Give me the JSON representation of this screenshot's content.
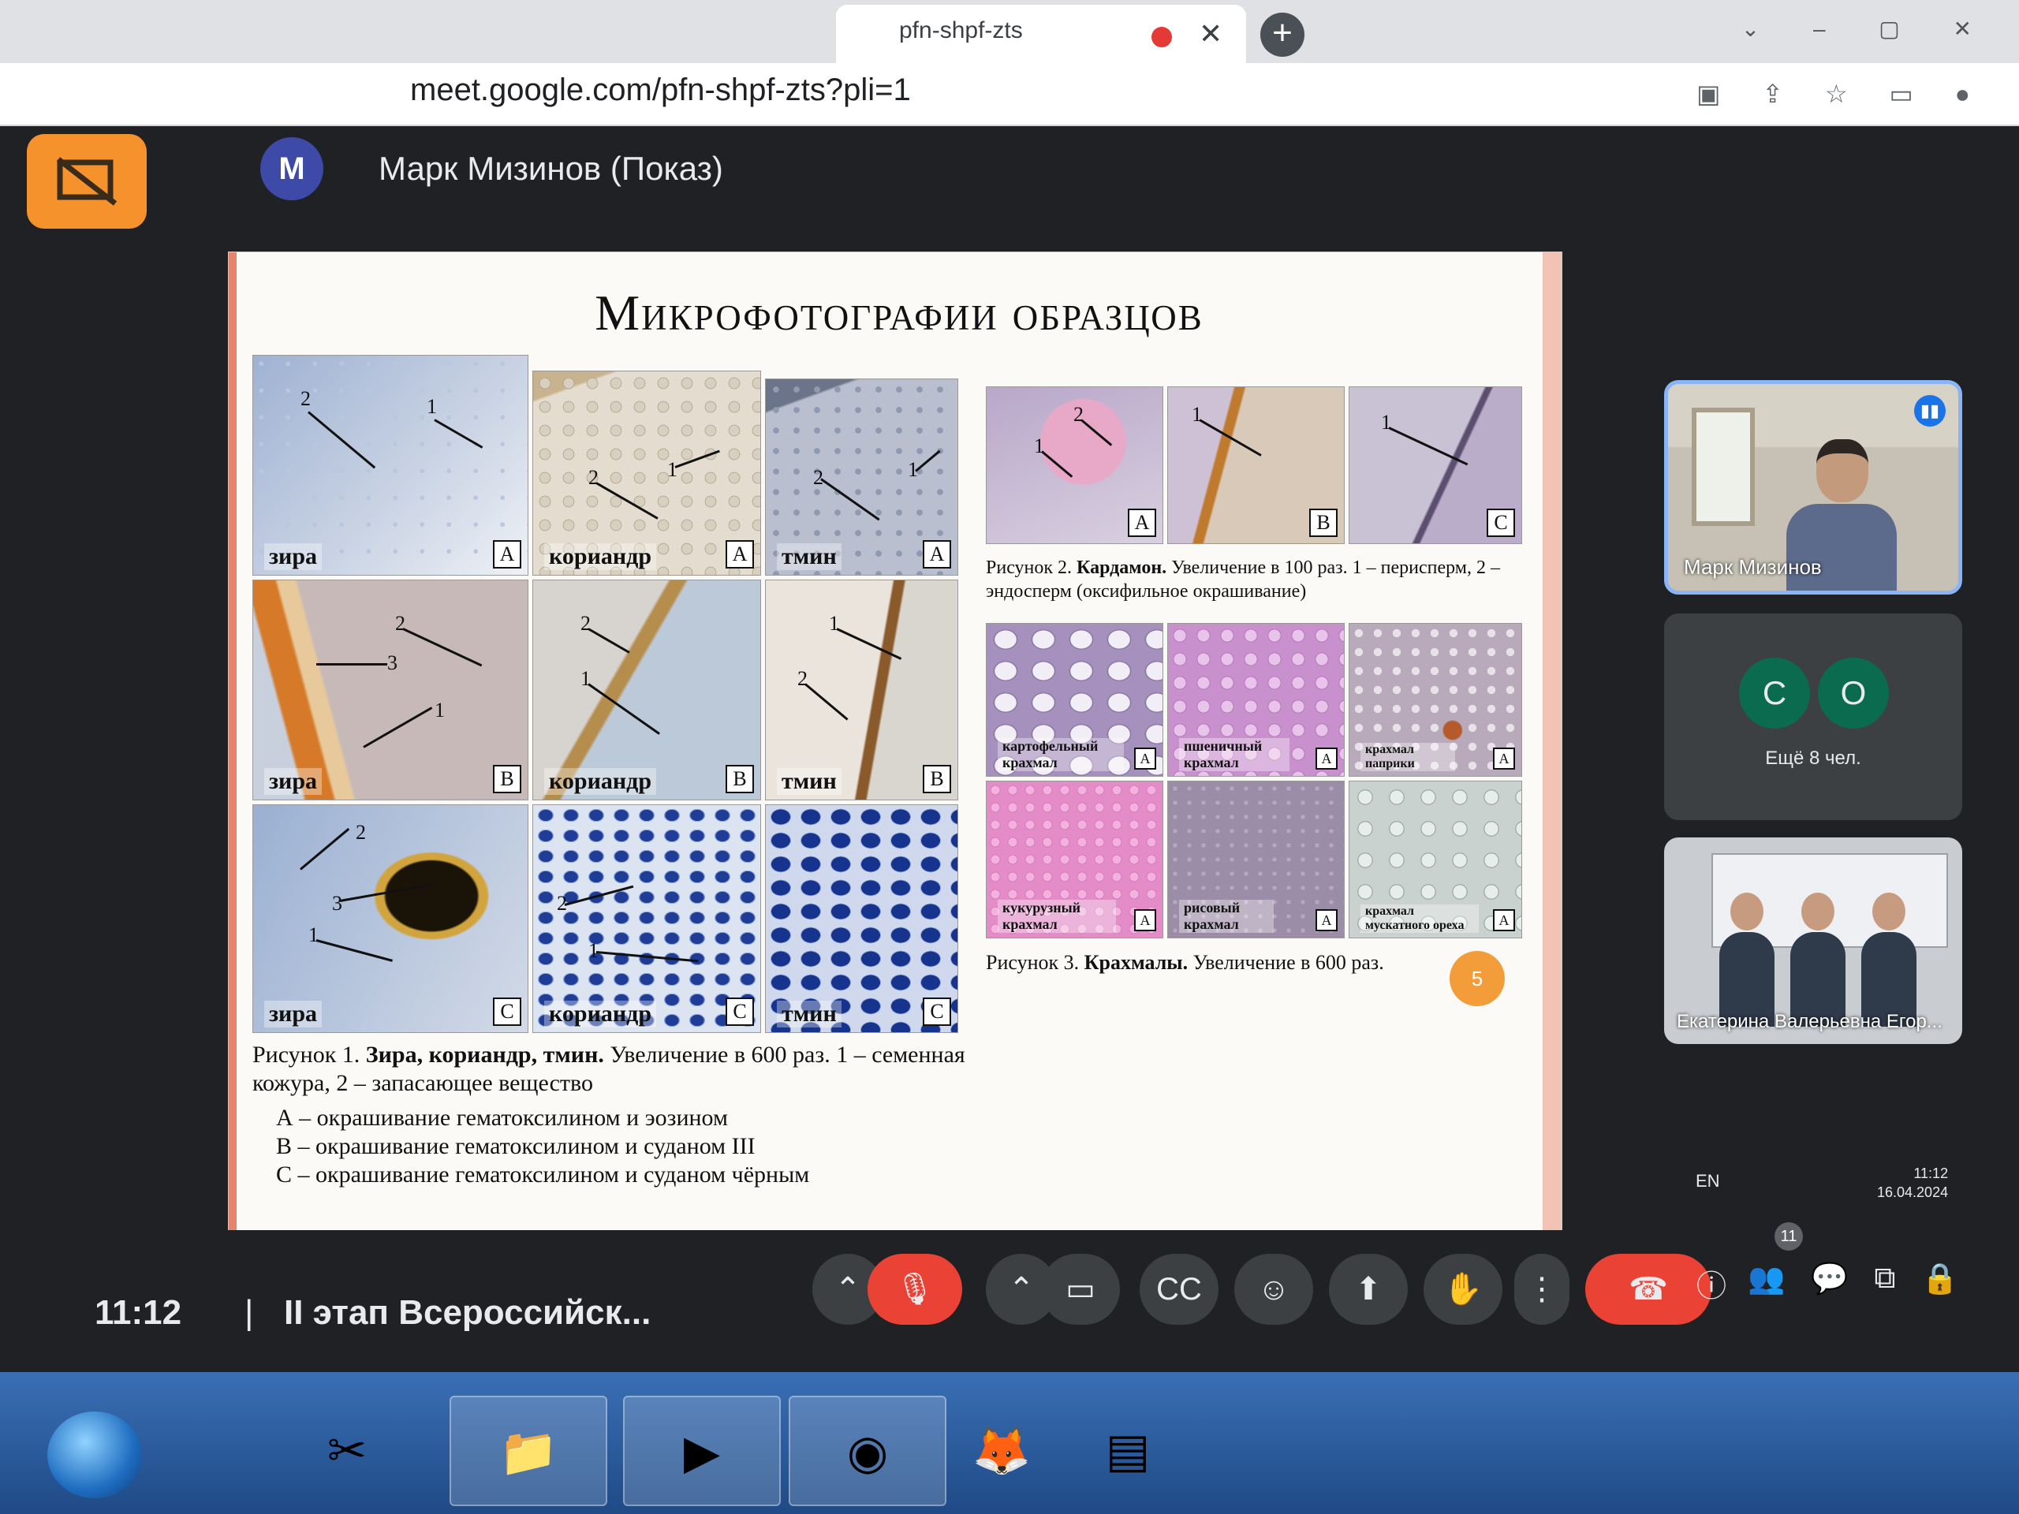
{
  "browser": {
    "tab_title": "pfn-shpf-zts",
    "url": "meet.google.com/pfn-shpf-zts?pli=1",
    "new_tab_label": "+"
  },
  "meet": {
    "presenter_initial": "M",
    "presenter_name": "Марк Мизинов (Показ)",
    "clock": "11:12",
    "separator": "|",
    "meeting_title": "II этап Всероссийск..."
  },
  "slide": {
    "title": "Микрофотографии образцов",
    "page_number": "5",
    "fig1": {
      "images": [
        {
          "label": "зира",
          "letter": "A"
        },
        {
          "label": "кориандр",
          "letter": "A"
        },
        {
          "label": "тмин",
          "letter": "A"
        },
        {
          "label": "зира",
          "letter": "B"
        },
        {
          "label": "кориандр",
          "letter": "B"
        },
        {
          "label": "тмин",
          "letter": "B"
        },
        {
          "label": "зира",
          "letter": "C"
        },
        {
          "label": "кориандр",
          "letter": "C"
        },
        {
          "label": "тмин",
          "letter": "C"
        }
      ],
      "caption_prefix": "Рисунок 1.",
      "caption_bold": "Зира, кориандр, тмин.",
      "caption_rest": "Увеличение в 600 раз. 1 – семенная кожура, 2 – запасающее вещество",
      "legend": [
        "А – окрашивание гематоксилином и эозином",
        "В – окрашивание гематоксилином и суданом III",
        "С – окрашивание гематоксилином и суданом чёрным"
      ]
    },
    "fig2": {
      "letters": [
        "A",
        "B",
        "C"
      ],
      "caption_prefix": "Рисунок 2.",
      "caption_bold": "Кардамон.",
      "caption_rest": "Увеличение в 100 раз. 1 – перисперм, 2 – эндосперм (оксифильное окрашивание)"
    },
    "fig3": {
      "images": [
        {
          "label": "картофельный крахмал",
          "letter": "A"
        },
        {
          "label": "пшеничный крахмал",
          "letter": "A"
        },
        {
          "label": "крахмал паприки",
          "letter": "A"
        },
        {
          "label": "кукурузный крахмал",
          "letter": "A"
        },
        {
          "label": "рисовый крахмал",
          "letter": "A"
        },
        {
          "label": "крахмал мускатного ореха",
          "letter": "A"
        }
      ],
      "caption_prefix": "Рисунок 3.",
      "caption_bold": "Крахмалы.",
      "caption_rest": "Увеличение в 600 раз."
    }
  },
  "participants": {
    "tile1_name": "Марк Мизинов",
    "avatar_c": "C",
    "avatar_o": "O",
    "others_label": "Ещё 8 чел.",
    "tile3_name": "Екатерина Валерьевна Егор...",
    "people_count": "11"
  },
  "system": {
    "language": "EN",
    "time": "11:12",
    "date": "16.04.2024"
  }
}
